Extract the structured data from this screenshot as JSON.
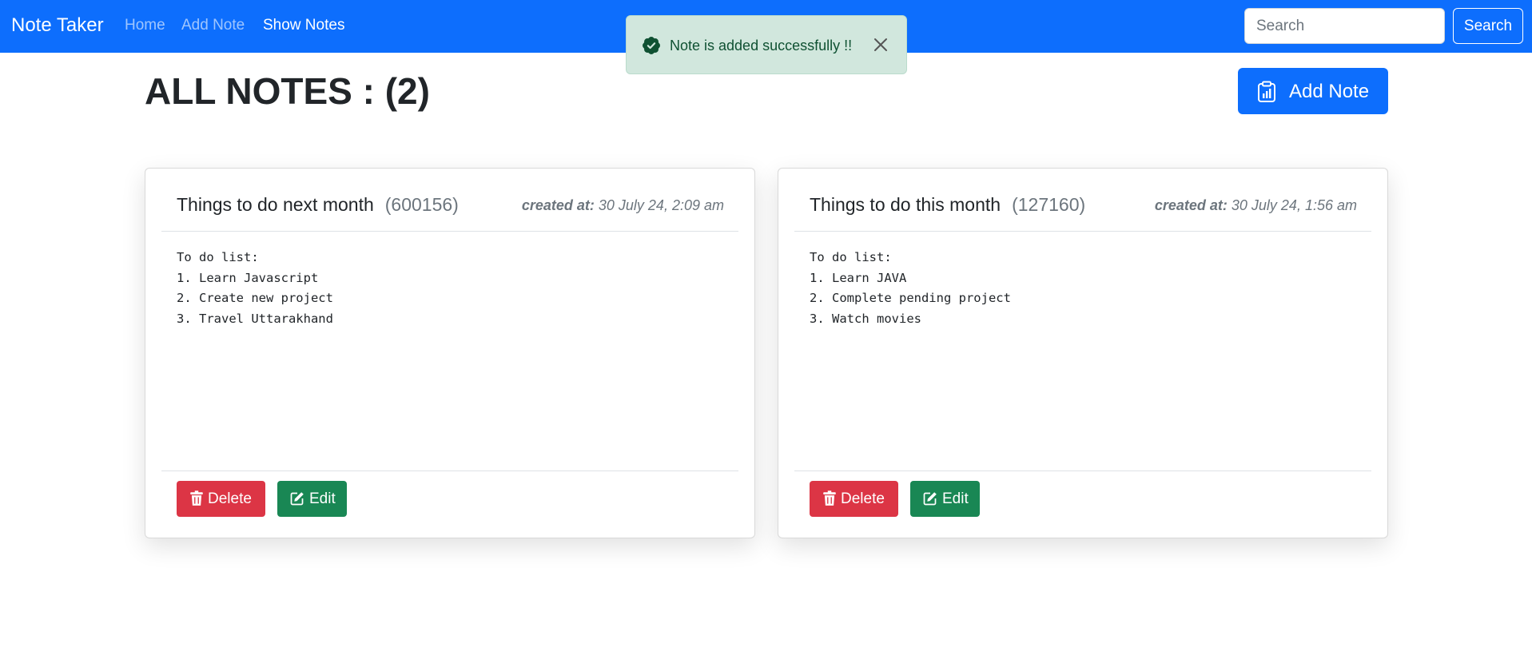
{
  "navbar": {
    "brand": "Note Taker",
    "links": [
      {
        "label": "Home"
      },
      {
        "label": "Add Note"
      },
      {
        "label": "Show Notes"
      }
    ],
    "search": {
      "placeholder": "Search",
      "value": ""
    },
    "search_button": "Search"
  },
  "toast": {
    "message": "Note is added successfully !!"
  },
  "page": {
    "title": "ALL NOTES : (2)",
    "add_note_button": "Add Note"
  },
  "notes": [
    {
      "title": "Things to do next month",
      "id": "(600156)",
      "created_label": "created at:",
      "created_value": "30 July 24, 2:09 am",
      "content": "To do list:\n1. Learn Javascript\n2. Create new project\n3. Travel Uttarakhand",
      "delete_label": "Delete",
      "edit_label": "Edit"
    },
    {
      "title": "Things to do this month",
      "id": "(127160)",
      "created_label": "created at:",
      "created_value": "30 July 24, 1:56 am",
      "content": "To do list:\n1. Learn JAVA\n2. Complete pending project\n3. Watch movies",
      "delete_label": "Delete",
      "edit_label": "Edit"
    }
  ],
  "colors": {
    "primary": "#0d6efd",
    "danger": "#dc3545",
    "success": "#198754",
    "toast_bg": "#d1e7dd",
    "toast_text": "#0f5132"
  }
}
